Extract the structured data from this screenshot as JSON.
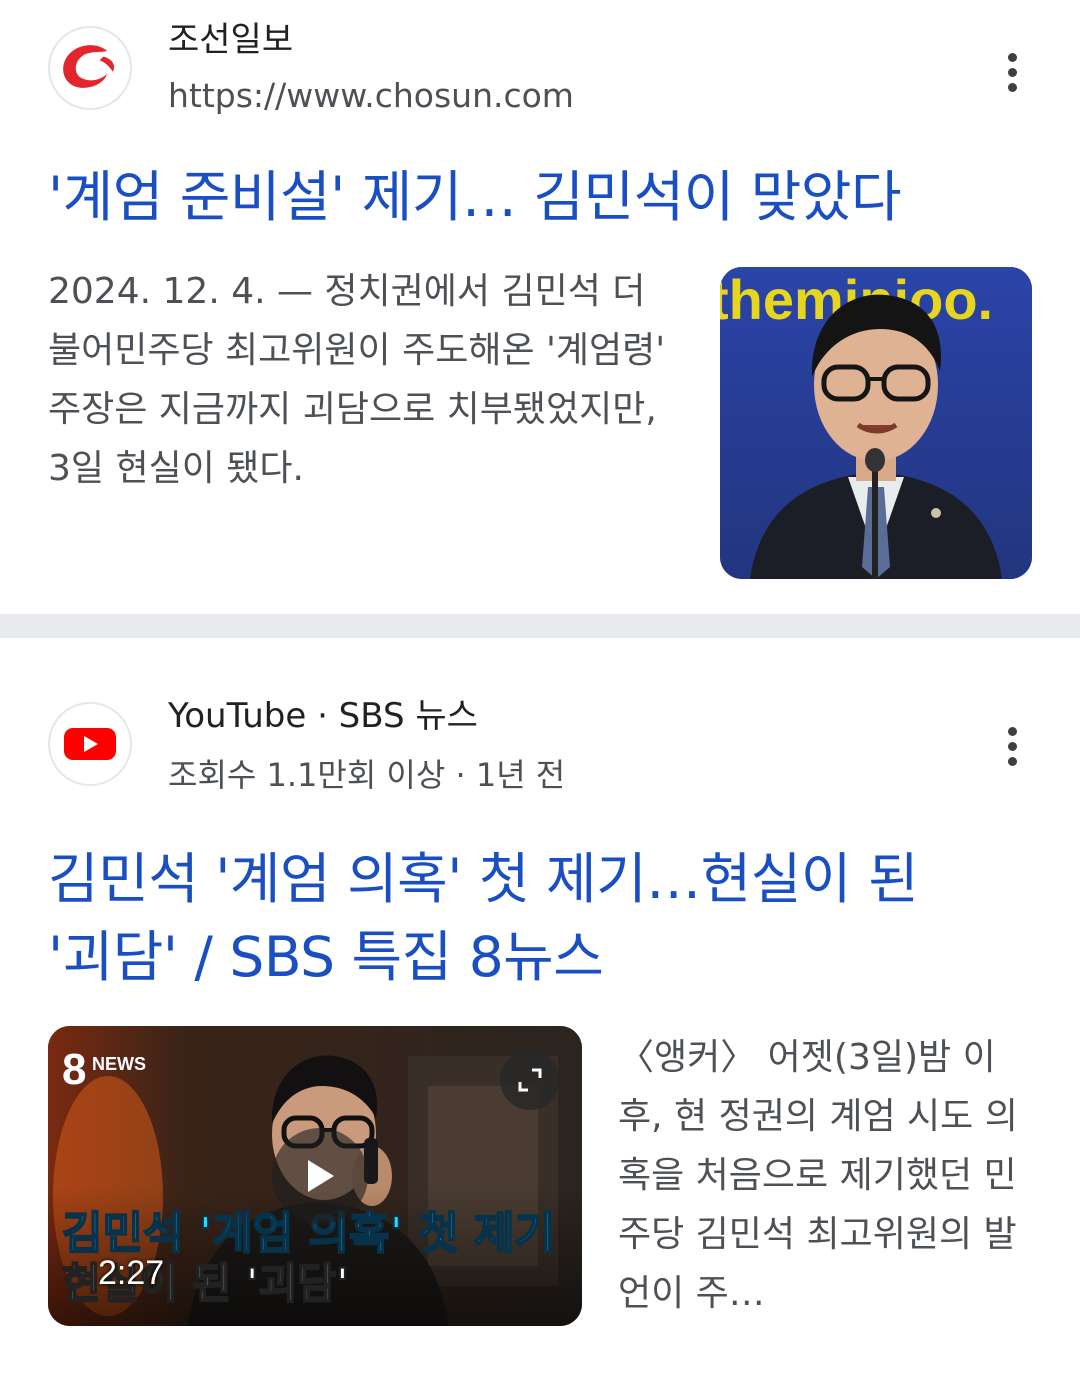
{
  "result1": {
    "source_name": "조선일보",
    "source_url": "https://www.chosun.com",
    "headline": "'계엄 준비설' 제기… 김민석이 맞았다",
    "snippet": "2024. 12. 4. — 정치권에서 김민석 더불어민주당 최고위원이 주도해온 '계엄령' 주장은 지금까지 괴담으로 치부됐었지만, 3일 현실이 됐다.",
    "logo_icon": "chosun-logo-icon",
    "thumbnail_backdrop_text": "theminjoo.",
    "more_icon": "more-vert-icon"
  },
  "result2": {
    "source_name": "YouTube · SBS 뉴스",
    "meta": "조회수 1.1만회 이상 · 1년 전",
    "headline_line1": "김민석 '계엄 의혹' 첫 제기…현실이 된",
    "headline_line2": "'괴담' / SBS 특집 8뉴스",
    "snippet": "〈앵커〉 어젯(3일)밤 이후, 현 정권의 계엄 시도 의혹을 처음으로 제기했던 민주당 김민석 최고위원의 발언이 주…",
    "logo_icon": "youtube-logo-icon",
    "video": {
      "news_badge": "8",
      "news_badge_text": "NEWS",
      "caption_line1": "김민석 '계엄 의혹' 첫 제기",
      "caption_line2": "현실이 된 '괴담'",
      "duration": "2:27",
      "play_icon": "play-icon",
      "expand_icon": "expand-icon"
    },
    "more_icon": "more-vert-icon"
  },
  "colors": {
    "link": "#1a4fc4",
    "text": "#202124",
    "secondary_text": "#4d5156",
    "divider": "#e8eaed",
    "chosun_red": "#e2262b",
    "youtube_red": "#ff0000",
    "caption_cyan": "#29d8ff"
  }
}
